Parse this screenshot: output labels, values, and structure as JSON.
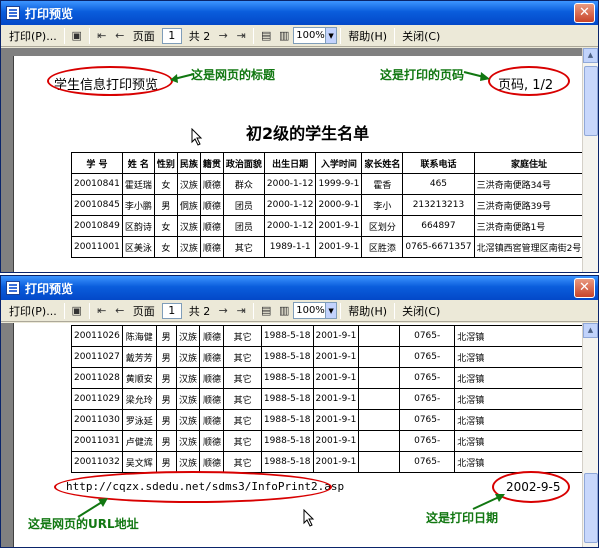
{
  "window_title": "打印预览",
  "toolbar": {
    "print_label": "打印(P)...",
    "page_label": "页面",
    "page_value": "1",
    "total_label": "共 2",
    "zoom_value": "100%",
    "help_label": "帮助(H)",
    "close_label": "关闭(C)"
  },
  "page1": {
    "header_title": "学生信息打印预览",
    "page_number": "页码, 1/2",
    "heading": "初2级的学生名单",
    "columns": [
      "学 号",
      "姓 名",
      "性别",
      "民族",
      "籍贯",
      "政治面貌",
      "出生日期",
      "入学时间",
      "家长姓名",
      "联系电话",
      "家庭住址"
    ],
    "rows": [
      [
        "20010841",
        "霍廷瑞",
        "女",
        "汉族",
        "顺德",
        "群众",
        "2000-1-12",
        "1999-9-1",
        "霍香",
        "465",
        "三洪奇南便路34号"
      ],
      [
        "20010845",
        "李小鹏",
        "男",
        "侗族",
        "顺德",
        "团员",
        "2000-1-12",
        "2000-9-1",
        "李小",
        "213213213",
        "三洪奇南便路39号"
      ],
      [
        "20010849",
        "区韵诗",
        "女",
        "汉族",
        "顺德",
        "团员",
        "2000-1-12",
        "2001-9-1",
        "区划分",
        "664897",
        "三洪奇南便路1号"
      ],
      [
        "20011001",
        "区美泳",
        "女",
        "汉族",
        "顺德",
        "其它",
        "1989-1-1",
        "2001-9-1",
        "区胜添",
        "0765-6671357",
        "北滘镇西窖管理区南街2号"
      ]
    ]
  },
  "page2": {
    "rows": [
      [
        "20011026",
        "陈海健",
        "男",
        "汉族",
        "顺德",
        "其它",
        "1988-5-18",
        "2001-9-1",
        "",
        "0765-",
        "北滘镇"
      ],
      [
        "20011027",
        "戴芳芳",
        "男",
        "汉族",
        "顺德",
        "其它",
        "1988-5-18",
        "2001-9-1",
        "",
        "0765-",
        "北滘镇"
      ],
      [
        "20011028",
        "黄顺安",
        "男",
        "汉族",
        "顺德",
        "其它",
        "1988-5-18",
        "2001-9-1",
        "",
        "0765-",
        "北滘镇"
      ],
      [
        "20011029",
        "梁允玲",
        "男",
        "汉族",
        "顺德",
        "其它",
        "1988-5-18",
        "2001-9-1",
        "",
        "0765-",
        "北滘镇"
      ],
      [
        "20011030",
        "罗泳延",
        "男",
        "汉族",
        "顺德",
        "其它",
        "1988-5-18",
        "2001-9-1",
        "",
        "0765-",
        "北滘镇"
      ],
      [
        "20011031",
        "卢健流",
        "男",
        "汉族",
        "顺德",
        "其它",
        "1988-5-18",
        "2001-9-1",
        "",
        "0765-",
        "北滘镇"
      ],
      [
        "20011032",
        "吴文辉",
        "男",
        "汉族",
        "顺德",
        "其它",
        "1988-5-18",
        "2001-9-1",
        "",
        "0765-",
        "北滘镇"
      ]
    ],
    "footer_url": "http://cqzx.sdedu.net/sdms3/InfoPrint2.asp",
    "footer_date": "2002-9-5"
  },
  "annotations": {
    "title_note": "这是网页的标题",
    "page_note": "这是打印的页码",
    "url_note": "这是网页的URL地址",
    "date_note": "这是打印日期"
  },
  "colors": {
    "annotation": "#117711",
    "ellipse": "#d80000",
    "titlebar": "#0a5ddc"
  }
}
